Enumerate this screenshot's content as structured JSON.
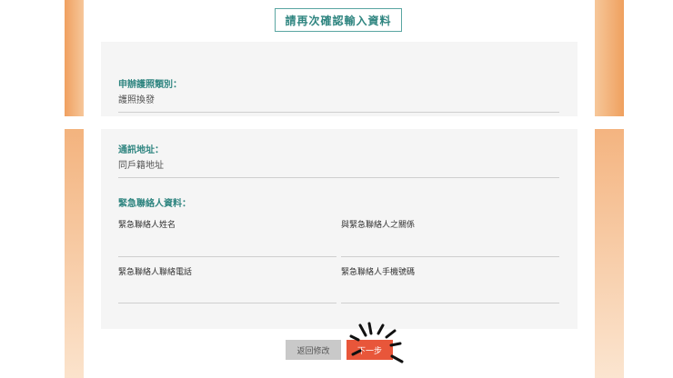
{
  "page": {
    "title": "請再次確認輸入資料"
  },
  "passport_section": {
    "label": "申辦護照類別：",
    "value": "護照換發"
  },
  "address_section": {
    "label": "通訊地址：",
    "value": "同戶籍地址"
  },
  "emergency_section": {
    "label": "緊急聯絡人資料：",
    "fields": [
      {
        "label": "緊急聯絡人姓名",
        "value": ""
      },
      {
        "label": "與緊急聯絡人之關係",
        "value": ""
      },
      {
        "label": "緊急聯絡人聯絡電話",
        "value": ""
      },
      {
        "label": "緊急聯絡人手機號碼",
        "value": ""
      }
    ]
  },
  "actions": {
    "back_label": "返回修改",
    "next_label": "下一步"
  },
  "colors": {
    "accent_teal": "#2f8580",
    "next_button": "#e8563a",
    "back_button": "#c9c9c9",
    "side_orange": "#f0a060"
  }
}
